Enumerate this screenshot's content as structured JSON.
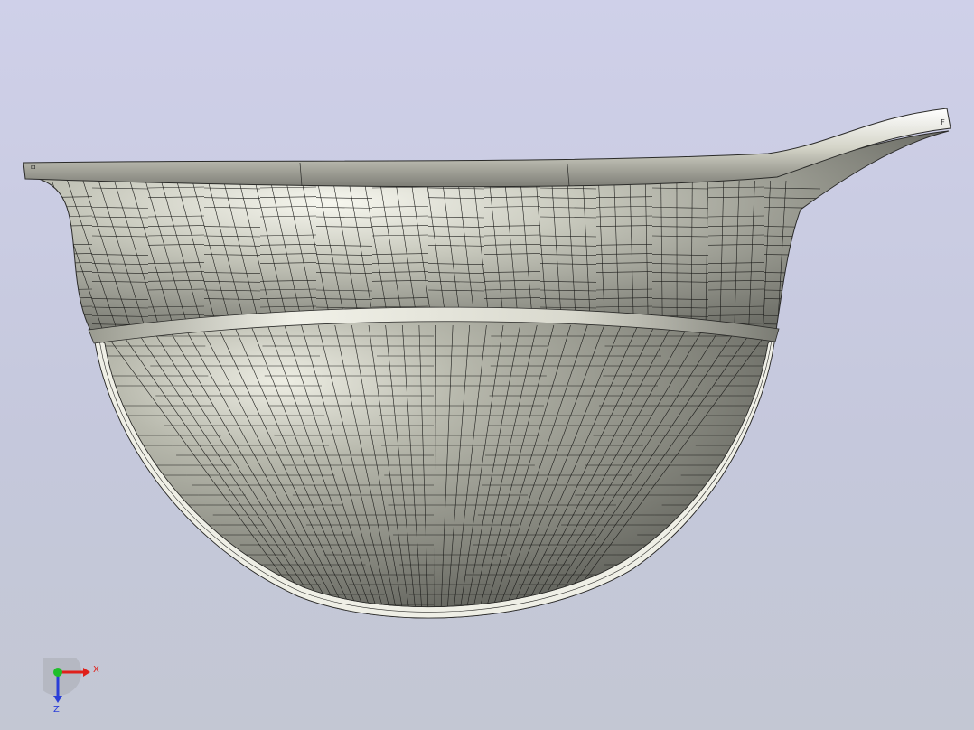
{
  "viewport": {
    "background_top": "#cfd0e9",
    "background_bottom": "#c3c7d3",
    "model": "helmet-shell-mesh",
    "mesh_color": "#1c1c1a",
    "shell_color": "#a9aaa0",
    "rim_highlight": "#f6f6ee"
  },
  "corner_marks": {
    "left": "ㅁ",
    "right": "F"
  },
  "triad": {
    "x_label": "X",
    "z_label": "Z",
    "x_color": "#e0201a",
    "y_color": "#1fbf2a",
    "z_color": "#2a3ed8"
  }
}
